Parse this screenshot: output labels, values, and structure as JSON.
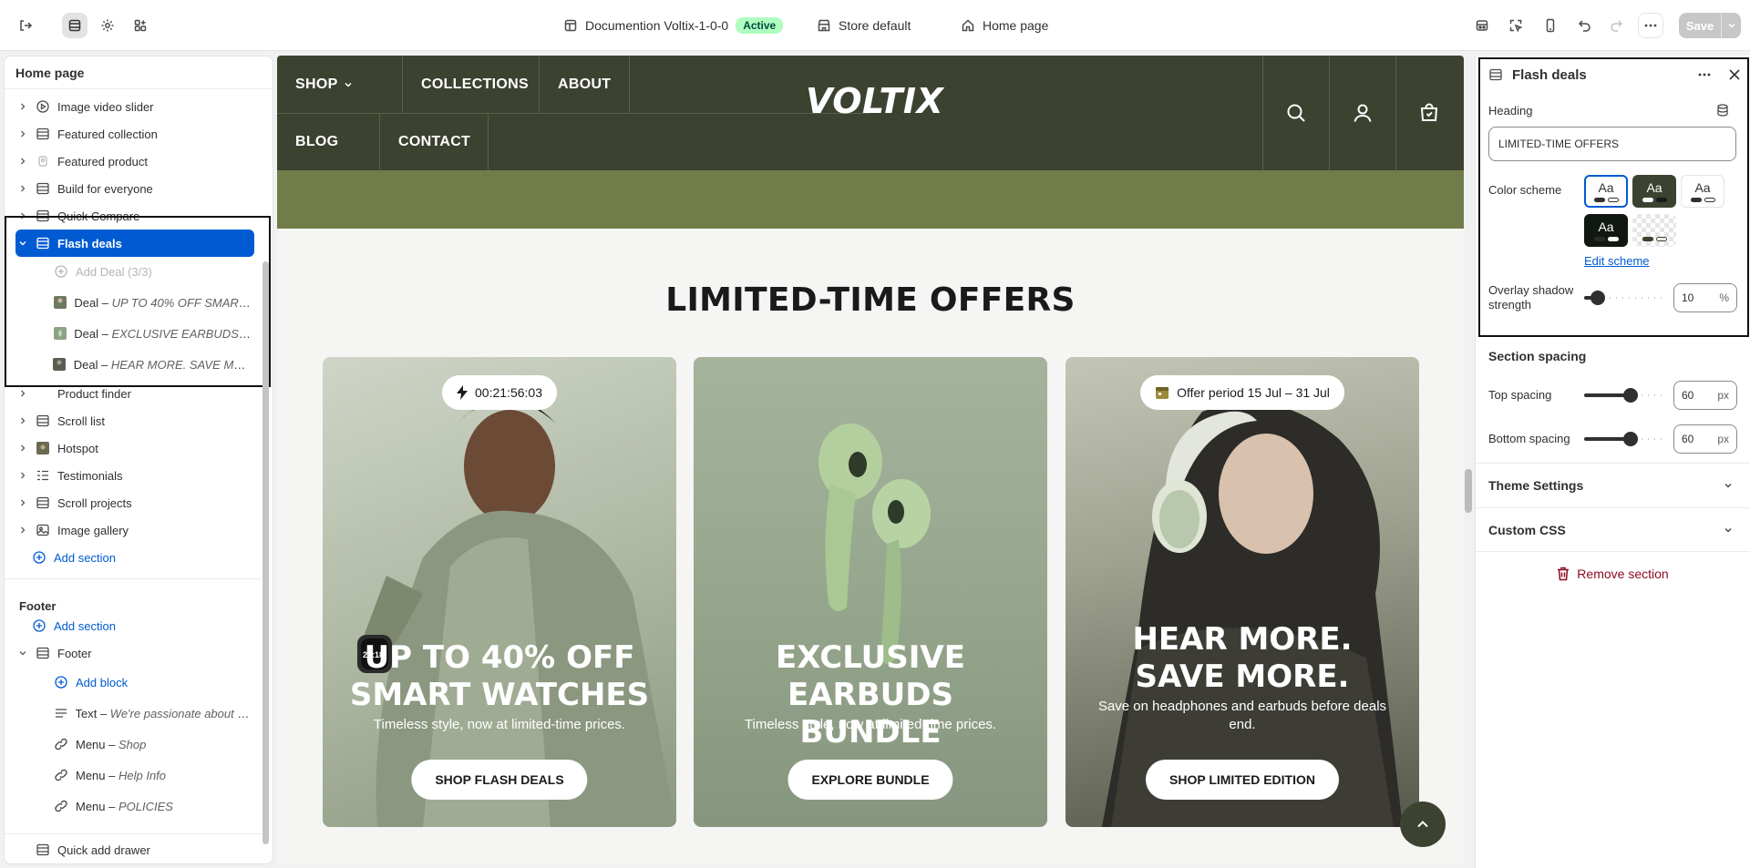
{
  "topbar": {
    "theme_name": "Documention Voltix-1-0-0",
    "status_badge": "Active",
    "store": "Store default",
    "page": "Home page",
    "save_label": "Save"
  },
  "sidebar": {
    "title": "Home page",
    "sections": [
      {
        "label": "Image video slider",
        "icon": "image-video-icon"
      },
      {
        "label": "Featured collection",
        "icon": "section-icon"
      },
      {
        "label": "Featured product",
        "icon": "product-icon"
      },
      {
        "label": "Build for everyone",
        "icon": "section-icon"
      },
      {
        "label": "Quick Compare",
        "icon": "section-icon"
      }
    ],
    "selected_section": "Flash deals",
    "add_deal": "Add Deal (3/3)",
    "deals": [
      {
        "prefix": "Deal – ",
        "name": "UP TO 40% OFF SMART ..."
      },
      {
        "prefix": "Deal – ",
        "name": "EXCLUSIVE EARBUDS B..."
      },
      {
        "prefix": "Deal – ",
        "name": "HEAR MORE. SAVE MORE."
      }
    ],
    "after_sections": [
      {
        "label": "Product finder",
        "icon": "none"
      },
      {
        "label": "Scroll list",
        "icon": "section-icon"
      },
      {
        "label": "Hotspot",
        "icon": "image-thumb-icon"
      },
      {
        "label": "Testimonials",
        "icon": "list-icon"
      },
      {
        "label": "Scroll projects",
        "icon": "section-icon"
      },
      {
        "label": "Image gallery",
        "icon": "gallery-icon"
      }
    ],
    "add_section": "Add section",
    "footer_group": "Footer",
    "footer_add_section": "Add section",
    "footer_section": "Footer",
    "footer_add_block": "Add block",
    "footer_blocks": [
      {
        "prefix": "Text – ",
        "name": "We're passionate about c..."
      },
      {
        "prefix": "Menu – ",
        "name": "Shop"
      },
      {
        "prefix": "Menu – ",
        "name": "Help Info"
      },
      {
        "prefix": "Menu – ",
        "name": "POLICIES"
      }
    ],
    "quick_add": "Quick add drawer"
  },
  "store": {
    "nav": [
      "SHOP",
      "COLLECTIONS",
      "ABOUT",
      "BLOG",
      "CONTACT"
    ],
    "logo": "VOLTIX",
    "section_heading": "LIMITED-TIME OFFERS",
    "cards": [
      {
        "badge": "00:21:56:03",
        "title": "UP TO 40% OFF SMART WATCHES",
        "subtitle": "Timeless style, now at limited-time prices.",
        "button": "SHOP FLASH DEALS"
      },
      {
        "badge": "",
        "title": "EXCLUSIVE EARBUDS BUNDLE",
        "subtitle": "Timeless style, now at limited-time prices.",
        "button": "EXPLORE BUNDLE"
      },
      {
        "badge": "Offer period 15 Jul – 31 Jul",
        "title": "HEAR MORE. SAVE MORE.",
        "subtitle": "Save on headphones and earbuds before deals end.",
        "button": "SHOP LIMITED EDITION"
      }
    ],
    "watch_time": "23:18"
  },
  "panel": {
    "title": "Flash deals",
    "heading_label": "Heading",
    "heading_value": "LIMITED-TIME OFFERS",
    "color_scheme_label": "Color scheme",
    "swatch_text": "Aa",
    "edit_scheme": "Edit scheme",
    "overlay_label": "Overlay shadow strength",
    "overlay_value": "10",
    "overlay_unit": "%",
    "overlay_fraction": 0.1,
    "section_spacing": "Section spacing",
    "top_spacing_label": "Top spacing",
    "top_spacing_value": "60",
    "bottom_spacing_label": "Bottom spacing",
    "bottom_spacing_value": "60",
    "px_unit": "px",
    "spacing_fraction": 0.6,
    "theme_settings": "Theme Settings",
    "custom_css": "Custom CSS",
    "remove_section": "Remove section"
  },
  "colors": {
    "accent": "#005bd3",
    "store_header": "#3c4230",
    "olive": "#707d48",
    "danger": "#8e0b21"
  }
}
